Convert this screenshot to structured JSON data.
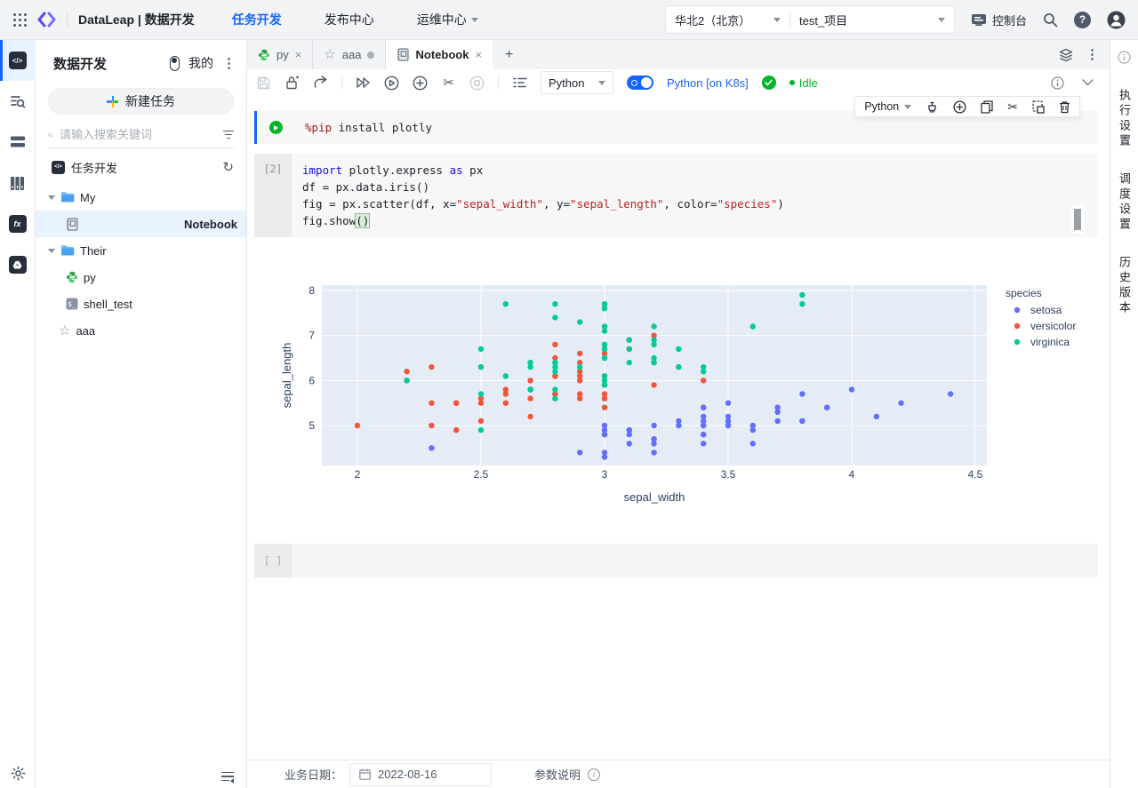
{
  "topbar": {
    "title": "DataLeap | 数据开发",
    "nav": [
      {
        "label": "任务开发",
        "active": true,
        "dropdown": false
      },
      {
        "label": "发布中心",
        "active": false,
        "dropdown": false
      },
      {
        "label": "运维中心",
        "active": false,
        "dropdown": true
      }
    ],
    "region": "华北2（北京）",
    "project": "test_项目",
    "console_label": "控制台",
    "help_glyph": "?"
  },
  "sidebar": {
    "title": "数据开发",
    "mine_label": "我的",
    "new_task_label": "新建任务",
    "search_placeholder": "请输入搜索关键词",
    "section_title": "任务开发",
    "tree": [
      {
        "label": "My",
        "type": "folder",
        "level": 0,
        "selected": false
      },
      {
        "label": "Notebook",
        "type": "notebook",
        "level": 1,
        "selected": true
      },
      {
        "label": "Their",
        "type": "folder",
        "level": 0,
        "selected": false
      },
      {
        "label": "py",
        "type": "python",
        "level": 1,
        "selected": false
      },
      {
        "label": "shell_test",
        "type": "shell",
        "level": 1,
        "selected": false
      },
      {
        "label": "aaa",
        "type": "star",
        "level": 0,
        "selected": false
      }
    ]
  },
  "tabs": [
    {
      "label": "py",
      "icon": "python",
      "closable": true,
      "dirty": false,
      "active": false
    },
    {
      "label": "aaa",
      "icon": "star",
      "closable": false,
      "dirty": true,
      "active": false
    },
    {
      "label": "Notebook",
      "icon": "notebook",
      "closable": true,
      "dirty": false,
      "active": true
    }
  ],
  "toolbar": {
    "kernel": "Python",
    "k8s_label": "Python [on K8s]",
    "status": "Idle"
  },
  "cell_toolbar": {
    "kernel": "Python"
  },
  "cells": {
    "cell1": {
      "lines": [
        [
          {
            "t": "%pip",
            "c": "magic"
          },
          {
            "t": " install plotly",
            "c": ""
          }
        ]
      ]
    },
    "cell2": {
      "exec_count": "[2]",
      "lines": [
        [
          {
            "t": "import",
            "c": "kw"
          },
          {
            "t": " plotly.express ",
            "c": ""
          },
          {
            "t": "as",
            "c": "kw"
          },
          {
            "t": " px",
            "c": ""
          }
        ],
        [
          {
            "t": "df = px.data.iris()",
            "c": ""
          }
        ],
        [
          {
            "t": "fig = px.scatter(df, x=",
            "c": ""
          },
          {
            "t": "\"sepal_width\"",
            "c": "str"
          },
          {
            "t": ", y=",
            "c": ""
          },
          {
            "t": "\"sepal_length\"",
            "c": "str"
          },
          {
            "t": ", color=",
            "c": ""
          },
          {
            "t": "\"species\"",
            "c": "str"
          },
          {
            "t": ")",
            "c": ""
          }
        ],
        [
          {
            "t": "fig.show",
            "c": ""
          },
          {
            "t": "()",
            "c": "bracket"
          }
        ]
      ]
    },
    "empty": {
      "gutter": "[ ]"
    }
  },
  "chart_data": {
    "type": "scatter",
    "title": "",
    "xlabel": "sepal_width",
    "ylabel": "sepal_length",
    "legend_title": "species",
    "legend_position": "right",
    "grid": true,
    "plot_bg": "#e5ecf6",
    "xlim": [
      1.856,
      4.547
    ],
    "ylim": [
      4.112,
      8.118
    ],
    "xticks": [
      2,
      2.5,
      3,
      3.5,
      4,
      4.5
    ],
    "yticks": [
      5,
      6,
      7,
      8
    ],
    "series": [
      {
        "name": "setosa",
        "color": "#636efa",
        "x": [
          3.5,
          3.0,
          3.2,
          3.1,
          3.6,
          3.9,
          3.4,
          3.4,
          2.9,
          3.1,
          3.7,
          3.4,
          3.0,
          3.0,
          4.0,
          4.4,
          3.9,
          3.5,
          3.8,
          3.8,
          3.4,
          3.7,
          3.6,
          3.3,
          3.4,
          3.0,
          3.4,
          3.5,
          3.4,
          3.2,
          3.1,
          3.4,
          4.1,
          4.2,
          3.1,
          3.2,
          3.5,
          3.6,
          3.0,
          3.4,
          3.5,
          2.3,
          3.2,
          3.5,
          3.8,
          3.0,
          3.8,
          3.2,
          3.7,
          3.3
        ],
        "y": [
          5.1,
          4.9,
          4.7,
          4.6,
          5.0,
          5.4,
          4.6,
          5.0,
          4.4,
          4.9,
          5.4,
          4.8,
          4.8,
          4.3,
          5.8,
          5.7,
          5.4,
          5.1,
          5.7,
          5.1,
          5.4,
          5.1,
          4.6,
          5.1,
          4.8,
          5.0,
          5.0,
          5.2,
          5.2,
          4.7,
          4.8,
          5.4,
          5.2,
          5.5,
          4.9,
          5.0,
          5.5,
          4.9,
          4.4,
          5.1,
          5.0,
          4.5,
          4.4,
          5.0,
          5.1,
          4.8,
          5.1,
          4.6,
          5.3,
          5.0
        ]
      },
      {
        "name": "versicolor",
        "color": "#ef553b",
        "x": [
          3.2,
          3.2,
          3.1,
          2.3,
          2.8,
          2.8,
          3.3,
          2.4,
          2.9,
          2.7,
          2.0,
          3.0,
          2.2,
          2.9,
          2.9,
          3.1,
          3.0,
          2.7,
          2.2,
          2.5,
          3.2,
          2.8,
          2.5,
          2.8,
          2.9,
          3.0,
          2.8,
          3.0,
          2.9,
          2.6,
          2.4,
          2.4,
          2.7,
          2.7,
          3.0,
          3.4,
          3.1,
          2.3,
          3.0,
          2.5,
          2.6,
          3.0,
          2.6,
          2.3,
          2.7,
          3.0,
          2.9,
          2.9,
          2.5,
          2.8
        ],
        "y": [
          7.0,
          6.4,
          6.9,
          5.5,
          6.5,
          5.7,
          6.3,
          4.9,
          6.6,
          5.2,
          5.0,
          5.9,
          6.0,
          6.1,
          5.6,
          6.7,
          5.6,
          5.8,
          6.2,
          5.6,
          5.9,
          6.1,
          6.3,
          6.1,
          6.4,
          6.6,
          6.8,
          6.7,
          6.0,
          5.7,
          5.5,
          5.5,
          5.8,
          6.0,
          5.4,
          6.0,
          6.7,
          6.3,
          5.6,
          5.5,
          5.5,
          6.1,
          5.8,
          5.0,
          5.6,
          5.7,
          5.7,
          6.2,
          5.1,
          5.7
        ]
      },
      {
        "name": "virginica",
        "color": "#00cc96",
        "x": [
          3.3,
          2.7,
          3.0,
          2.9,
          3.0,
          3.0,
          2.5,
          2.9,
          2.5,
          3.6,
          3.2,
          2.7,
          3.0,
          2.5,
          2.8,
          3.2,
          3.0,
          3.8,
          2.6,
          2.2,
          3.2,
          2.8,
          2.8,
          2.7,
          3.3,
          3.2,
          2.8,
          3.0,
          2.8,
          3.0,
          2.8,
          3.8,
          2.8,
          2.8,
          2.6,
          3.0,
          3.4,
          3.1,
          3.0,
          3.1,
          3.1,
          3.1,
          2.7,
          3.2,
          3.3,
          3.0,
          2.5,
          3.0,
          3.4,
          3.0
        ],
        "y": [
          6.3,
          5.8,
          7.1,
          6.3,
          6.5,
          7.6,
          4.9,
          7.3,
          6.7,
          7.2,
          6.5,
          6.4,
          6.8,
          5.7,
          5.8,
          6.4,
          6.5,
          7.7,
          7.7,
          6.0,
          6.9,
          5.6,
          7.7,
          6.3,
          6.7,
          7.2,
          6.2,
          6.1,
          6.4,
          7.2,
          7.4,
          7.9,
          6.4,
          6.3,
          6.1,
          7.7,
          6.3,
          6.4,
          6.0,
          6.9,
          6.7,
          6.9,
          5.8,
          6.8,
          6.7,
          6.7,
          6.3,
          6.5,
          6.2,
          5.9
        ]
      }
    ]
  },
  "right_panel": {
    "tabs": [
      "执行设置",
      "调度设置",
      "历史版本"
    ]
  },
  "statusbar": {
    "date_label": "业务日期：",
    "date_value": "2022-08-16",
    "params_label": "参数说明"
  }
}
